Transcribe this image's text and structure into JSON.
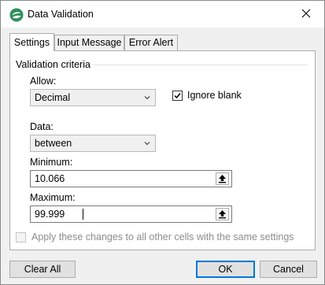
{
  "window": {
    "title": "Data Validation"
  },
  "tabs": [
    {
      "label": "Settings",
      "active": true
    },
    {
      "label": "Input Message",
      "active": false
    },
    {
      "label": "Error Alert",
      "active": false
    }
  ],
  "criteria": {
    "group_label": "Validation criteria",
    "allow_label": "Allow:",
    "allow_value": "Decimal",
    "ignore_blank_label": "Ignore blank",
    "ignore_blank_checked": true,
    "data_label": "Data:",
    "data_value": "between",
    "minimum_label": "Minimum:",
    "minimum_value": "10.066",
    "maximum_label": "Maximum:",
    "maximum_value": "99.999"
  },
  "apply_all": {
    "label": "Apply these changes to all other cells with the same settings",
    "checked": false,
    "enabled": false
  },
  "buttons": {
    "clear_all": "Clear All",
    "ok": "OK",
    "cancel": "Cancel"
  },
  "colors": {
    "accent": "#0078d7",
    "app_icon_green": "#2f8f5b"
  }
}
